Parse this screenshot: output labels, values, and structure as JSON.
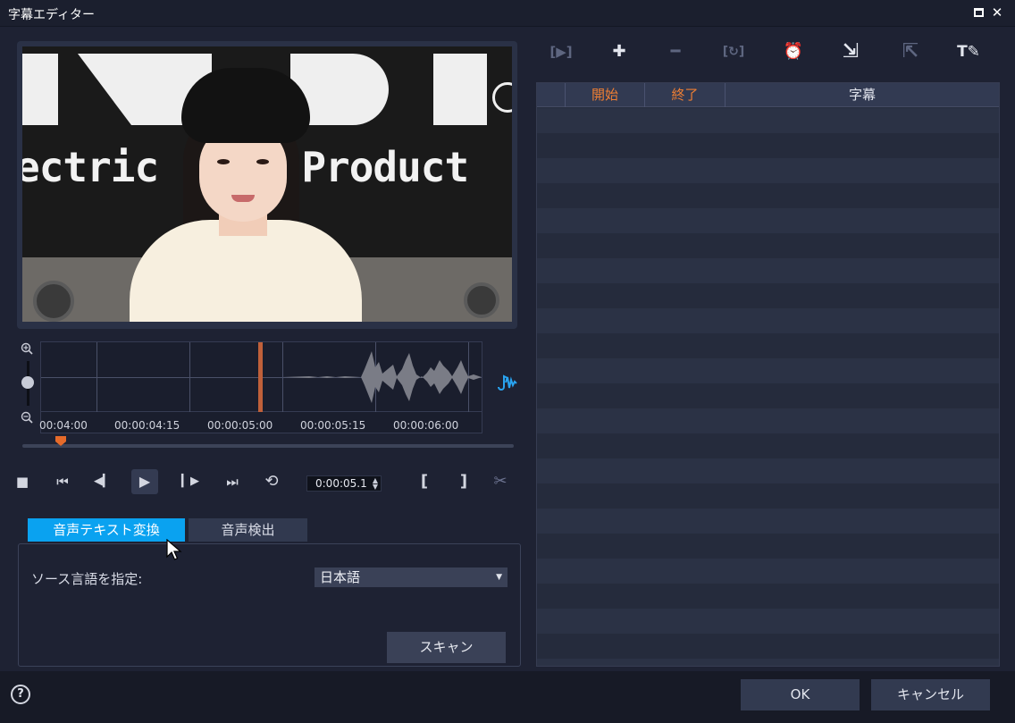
{
  "window": {
    "title": "字幕エディター",
    "maximize_glyph": "",
    "close_glyph": "✕"
  },
  "preview": {
    "banner_text": "ectric  So   l  Product"
  },
  "waveform": {
    "tick_labels": [
      "00:04:00",
      "00:00:04:15",
      "00:00:05:00",
      "00:00:05:15",
      "00:00:06:00"
    ]
  },
  "transport": {
    "timecode": "0:00:05.1",
    "stop_glyph": "■",
    "prev_glyph": "⏮",
    "step_back_glyph": "◀▎",
    "play_glyph": "▶",
    "step_fwd_glyph": "▎▶",
    "next_glyph": "⏭",
    "repeat_glyph": "⟲",
    "mark_in_glyph": "[",
    "mark_out_glyph": "]",
    "cut_glyph": "✂"
  },
  "tabs": [
    {
      "label": "音声テキスト変換",
      "active": true
    },
    {
      "label": "音声検出",
      "active": false
    }
  ],
  "panel": {
    "source_label": "ソース言語を指定:",
    "language_value": "日本語",
    "scan_label": "スキャン"
  },
  "subtitle_toolbar": [
    {
      "icon": "play-subtitle-icon",
      "glyph": "[▶]",
      "enabled": false
    },
    {
      "icon": "add-icon",
      "glyph": "✚",
      "enabled": true
    },
    {
      "icon": "remove-icon",
      "glyph": "━",
      "enabled": false
    },
    {
      "icon": "merge-icon",
      "glyph": "[↻]",
      "enabled": false
    },
    {
      "icon": "time-offset-icon",
      "glyph": "⏰",
      "enabled": false
    },
    {
      "icon": "import-icon",
      "glyph": "⇲",
      "enabled": true
    },
    {
      "icon": "export-icon",
      "glyph": "⇱",
      "enabled": false
    },
    {
      "icon": "text-style-icon",
      "glyph": "T✎",
      "enabled": true
    }
  ],
  "subtitle_table": {
    "columns": [
      "",
      "開始",
      "終了",
      "字幕"
    ]
  },
  "footer": {
    "help_glyph": "?",
    "ok_label": "OK",
    "cancel_label": "キャンセル"
  },
  "colors": {
    "accent": "#0aa2f0",
    "header_highlight": "#f07f33",
    "playhead": "#e56a2a"
  }
}
